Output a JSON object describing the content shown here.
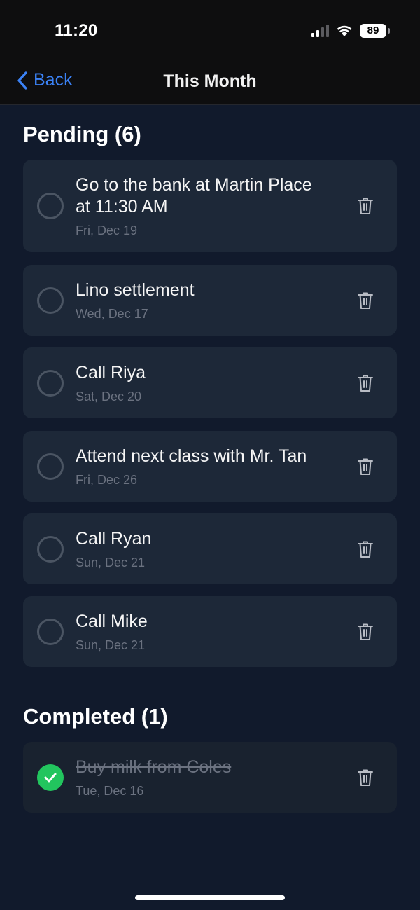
{
  "status_bar": {
    "time": "11:20",
    "battery": "89",
    "icons": [
      "signal-icon",
      "wifi-icon",
      "battery-icon"
    ]
  },
  "nav": {
    "back_label": "Back",
    "title": "This Month",
    "back_icon": "chevron-left-icon"
  },
  "pending": {
    "heading": "Pending (6)",
    "items": [
      {
        "title_line1": "Go to the bank at Martin Place",
        "title_line2": "at 11:30 AM",
        "date": "Fri, Dec 19"
      },
      {
        "title": "Lino settlement",
        "date": "Wed, Dec 17"
      },
      {
        "title": "Call Riya",
        "date": "Sat, Dec 20"
      },
      {
        "title": "Attend next class with Mr. Tan",
        "date": "Fri, Dec 26"
      },
      {
        "title": "Call Ryan",
        "date": "Sun, Dec 21"
      },
      {
        "title": "Call Mike",
        "date": "Sun, Dec 21"
      }
    ]
  },
  "completed": {
    "heading": "Completed (1)",
    "items": [
      {
        "title": "Buy milk from Coles",
        "date": "Tue, Dec 16"
      }
    ]
  },
  "colors": {
    "accent": "#3b82f6",
    "done": "#22c55e",
    "card": "#1d2838",
    "background": "#111a2c"
  }
}
